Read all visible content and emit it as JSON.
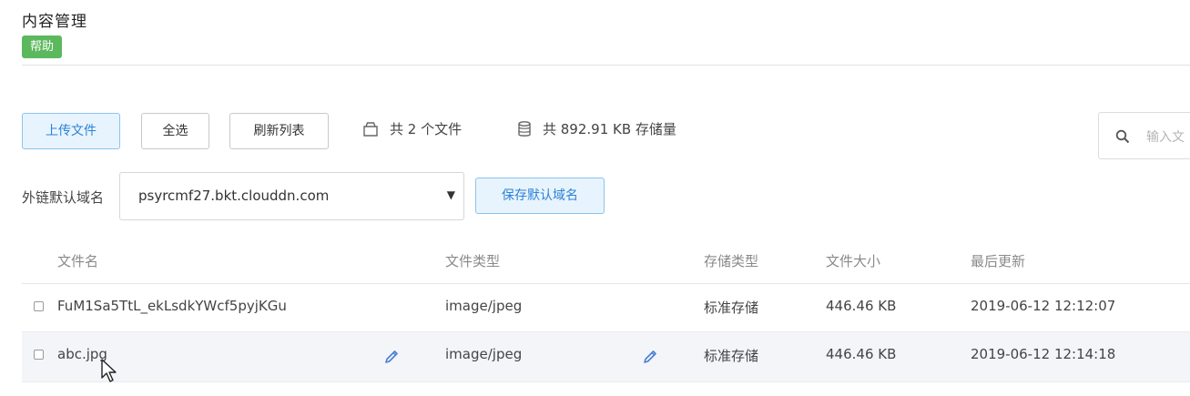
{
  "header": {
    "title": "内容管理",
    "help_label": "帮助"
  },
  "toolbar": {
    "upload_label": "上传文件",
    "select_all_label": "全选",
    "refresh_label": "刷新列表",
    "file_count_text": "共 2 个文件",
    "storage_text": "共 892.91 KB 存储量",
    "search_placeholder": "输入文"
  },
  "domain": {
    "label": "外链默认域名",
    "selected_value": "psyrcmf27.bkt.clouddn.com",
    "save_label": "保存默认域名"
  },
  "table": {
    "columns": [
      "文件名",
      "文件类型",
      "存储类型",
      "文件大小",
      "最后更新"
    ],
    "rows": [
      {
        "name": "FuM1Sa5TtL_ekLsdkYWcf5pyjKGu",
        "type": "image/jpeg",
        "storage": "标准存储",
        "size": "446.46 KB",
        "updated": "2019-06-12 12:12:07"
      },
      {
        "name": "abc.jpg",
        "type": "image/jpeg",
        "storage": "标准存储",
        "size": "446.46 KB",
        "updated": "2019-06-12 12:14:18"
      }
    ]
  },
  "icons": {
    "file_count": "box-icon",
    "storage": "database-icon",
    "search": "search-icon",
    "edit": "pencil-icon",
    "dropdown": "caret-down-icon",
    "cursor": "mouse-pointer-icon"
  },
  "colors": {
    "help_badge": "#5cb85c",
    "primary_text": "#2c82d6",
    "primary_bg": "#e8f4fd",
    "edit_icon": "#4a7fd4",
    "selected_row_bg": "#f3f5f9"
  }
}
